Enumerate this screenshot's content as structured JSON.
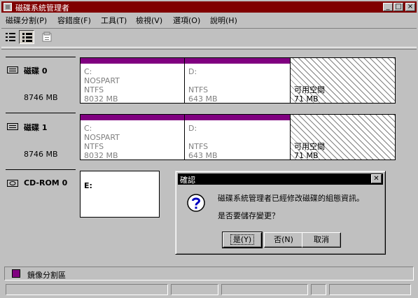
{
  "window": {
    "title": "磁碟系統管理者"
  },
  "title_buttons": [
    "_",
    "□",
    "×"
  ],
  "menu": [
    "磁碟分割(P)",
    "容錯度(F)",
    "工具(T)",
    "檢視(V)",
    "選項(O)",
    "說明(H)"
  ],
  "toolbar": {
    "tools": [
      "list-view-icon",
      "disk-view-icon",
      "properties-icon"
    ]
  },
  "disks": [
    {
      "name": "磁碟 0",
      "size": "8746 MB",
      "partitions": [
        {
          "letter": "C:",
          "label": "NOSPART",
          "fs": "NTFS",
          "size": "8032 MB"
        },
        {
          "letter": "D:",
          "label": "",
          "fs": "NTFS",
          "size": "643 MB"
        }
      ],
      "free": {
        "label": "可用空間",
        "size": "71 MB"
      }
    },
    {
      "name": "磁碟 1",
      "size": "8746 MB",
      "partitions": [
        {
          "letter": "C:",
          "label": "NOSPART",
          "fs": "NTFS",
          "size": "8032 MB"
        },
        {
          "letter": "D:",
          "label": "",
          "fs": "NTFS",
          "size": "643 MB"
        }
      ],
      "free": {
        "label": "可用空間",
        "size": "71 MB"
      }
    }
  ],
  "cdrom": {
    "name": "CD-ROM 0",
    "letter": "E:"
  },
  "legend": {
    "label": "鏡像分割區",
    "color": "#800080"
  },
  "dialog": {
    "title": "確認",
    "message_line1": "磁碟系統管理者已經修改磁碟的組態資訊。",
    "message_line2": "是否要儲存變更？",
    "yes": "是(Y)",
    "no": "否(N)",
    "cancel": "取消"
  },
  "colors": {
    "title_bar": "#800000",
    "mirror": "#800080",
    "face": "#c0c0c0"
  }
}
